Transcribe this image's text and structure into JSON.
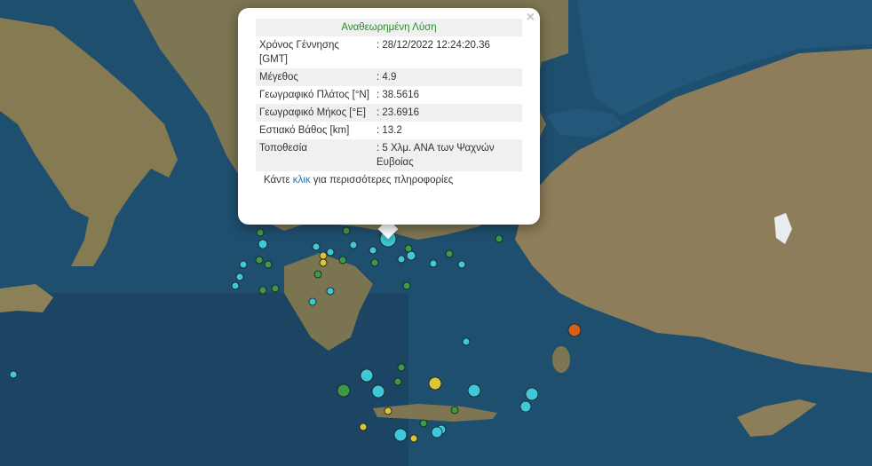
{
  "popup": {
    "title": "Αναθεωρημένη Λύση",
    "close": "×",
    "rows": [
      {
        "label": "Χρόνος Γέννησης [GMT]",
        "value": ": 28/12/2022 12:24:20.36"
      },
      {
        "label": "Μέγεθος",
        "value": ": 4.9"
      },
      {
        "label": "Γεωγραφικό Πλάτος [°N]",
        "value": ": 38.5616"
      },
      {
        "label": "Γεωγραφικό Μήκος [°E]",
        "value": ": 23.6916"
      },
      {
        "label": "Εστιακό Βάθος [km]",
        "value": ": 13.2"
      },
      {
        "label": "Τοποθεσία",
        "value": ": 5 Χλμ. ΑΝΑ των Ψαχνών Ευβοίας"
      }
    ],
    "more_prefix": "Κάντε ",
    "more_link": "κλικ",
    "more_suffix": " για περισσότερες πληροφορίες"
  },
  "colors": {
    "sea": "#1f4f6e",
    "land": "#8a7a55",
    "cyan_marker": "#3fc8d8",
    "green_marker": "#3a9a4a",
    "yellow_marker": "#d9c43a",
    "orange_marker": "#d2601a",
    "title_green": "#2a8a2a",
    "link_blue": "#1a78c2"
  },
  "markers": [
    {
      "c": "cyan"
    },
    {
      "c": "green"
    },
    {
      "c": "cyan"
    },
    {
      "c": "green"
    },
    {
      "c": "cyan"
    },
    {
      "c": "green"
    },
    {
      "c": "yellow"
    },
    {
      "c": "cyan"
    },
    {
      "c": "green"
    },
    {
      "c": "cyan"
    },
    {
      "c": "green"
    },
    {
      "c": "cyan"
    },
    {
      "c": "cyan"
    },
    {
      "c": "green"
    },
    {
      "c": "cyan"
    },
    {
      "c": "green"
    },
    {
      "c": "cyan"
    },
    {
      "c": "green"
    },
    {
      "c": "cyan"
    },
    {
      "c": "green"
    },
    {
      "c": "cyan"
    },
    {
      "c": "cyan"
    },
    {
      "c": "green"
    },
    {
      "c": "yellow"
    },
    {
      "c": "cyan"
    },
    {
      "c": "green"
    },
    {
      "c": "cyan"
    },
    {
      "c": "green"
    },
    {
      "c": "cyan"
    },
    {
      "c": "green"
    },
    {
      "c": "orange"
    },
    {
      "c": "cyan"
    },
    {
      "c": "green"
    },
    {
      "c": "cyan"
    },
    {
      "c": "green"
    },
    {
      "c": "cyan"
    },
    {
      "c": "yellow"
    },
    {
      "c": "cyan"
    },
    {
      "c": "cyan"
    },
    {
      "c": "cyan"
    },
    {
      "c": "green"
    },
    {
      "c": "green"
    },
    {
      "c": "yellow"
    },
    {
      "c": "cyan"
    },
    {
      "c": "yellow"
    },
    {
      "c": "cyan"
    },
    {
      "c": "green"
    },
    {
      "c": "yellow"
    },
    {
      "c": "cyan"
    },
    {
      "c": "cyan"
    }
  ]
}
